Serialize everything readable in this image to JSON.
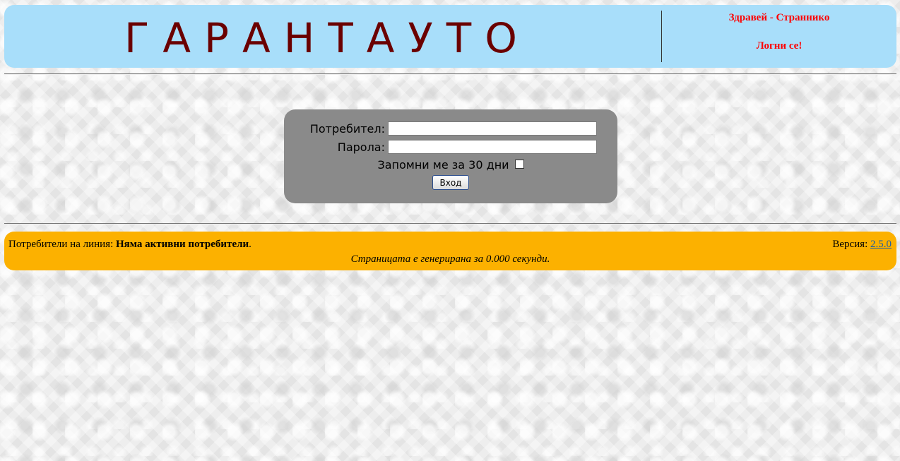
{
  "header": {
    "site_title": "ГАРАНТАУТО",
    "welcome_text": "Здравей - Страннико",
    "login_link": "Логни се!",
    "background_color": "#a8defa",
    "title_color": "#6b0000",
    "link_color": "#ff0000"
  },
  "login_form": {
    "username_label": "Потребител:",
    "username_value": "",
    "password_label": "Парола:",
    "password_value": "",
    "remember_label": "Запомни ме за 30 дни",
    "remember_checked": false,
    "submit_label": "Вход",
    "box_color": "#8a8a8a"
  },
  "footer": {
    "online_label": "Потребители на линия:",
    "online_value": "Няма активни потребители",
    "online_suffix": ".",
    "version_label": "Версия:",
    "version_value": "2.5.0",
    "generated_text": "Страницата е генерирана за 0.000 секунди.",
    "background_color": "#fcb100"
  }
}
